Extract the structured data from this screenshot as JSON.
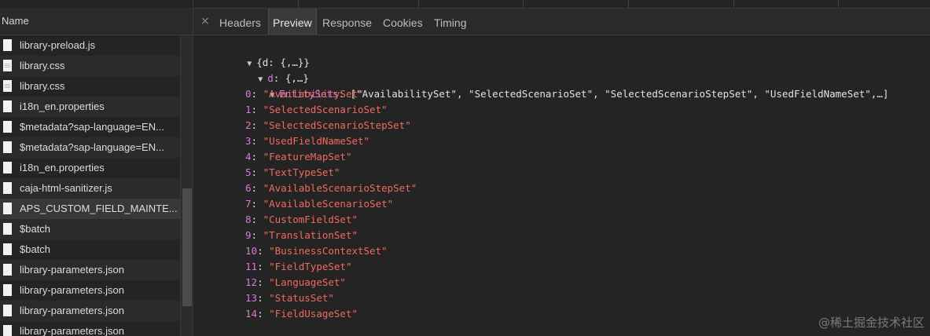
{
  "request_list": {
    "header": "Name",
    "items": [
      {
        "name": "library-preload.js",
        "icon": "js-file-icon"
      },
      {
        "name": "library.css",
        "icon": "css-file-icon"
      },
      {
        "name": "library.css",
        "icon": "css-file-icon"
      },
      {
        "name": "i18n_en.properties",
        "icon": "file-icon"
      },
      {
        "name": "$metadata?sap-language=EN...",
        "icon": "file-icon"
      },
      {
        "name": "$metadata?sap-language=EN...",
        "icon": "file-icon"
      },
      {
        "name": "i18n_en.properties",
        "icon": "file-icon"
      },
      {
        "name": "caja-html-sanitizer.js",
        "icon": "js-file-icon"
      },
      {
        "name": "APS_CUSTOM_FIELD_MAINTE...",
        "icon": "file-icon"
      },
      {
        "name": "$batch",
        "icon": "file-icon"
      },
      {
        "name": "$batch",
        "icon": "file-icon"
      },
      {
        "name": "library-parameters.json",
        "icon": "file-icon"
      },
      {
        "name": "library-parameters.json",
        "icon": "file-icon"
      },
      {
        "name": "library-parameters.json",
        "icon": "file-icon"
      },
      {
        "name": "library-parameters.json",
        "icon": "file-icon"
      }
    ]
  },
  "tabs": {
    "close": "×",
    "items": [
      "Headers",
      "Preview",
      "Response",
      "Cookies",
      "Timing"
    ],
    "active": "Preview"
  },
  "preview": {
    "root": "{d: {,…}}",
    "d_key": "d",
    "d_value": "{,…}",
    "entity_sets_key": "EntitySets",
    "entity_sets_summary": "[\"AvailabilitySet\", \"SelectedScenarioSet\", \"SelectedScenarioStepSet\", \"UsedFieldNameSet\",…]",
    "entries": [
      {
        "index": "0",
        "value": "\"AvailabilitySet\""
      },
      {
        "index": "1",
        "value": "\"SelectedScenarioSet\""
      },
      {
        "index": "2",
        "value": "\"SelectedScenarioStepSet\""
      },
      {
        "index": "3",
        "value": "\"UsedFieldNameSet\""
      },
      {
        "index": "4",
        "value": "\"FeatureMapSet\""
      },
      {
        "index": "5",
        "value": "\"TextTypeSet\""
      },
      {
        "index": "6",
        "value": "\"AvailableScenarioStepSet\""
      },
      {
        "index": "7",
        "value": "\"AvailableScenarioSet\""
      },
      {
        "index": "8",
        "value": "\"CustomFieldSet\""
      },
      {
        "index": "9",
        "value": "\"TranslationSet\""
      },
      {
        "index": "10",
        "value": "\"BusinessContextSet\""
      },
      {
        "index": "11",
        "value": "\"FieldTypeSet\""
      },
      {
        "index": "12",
        "value": "\"LanguageSet\""
      },
      {
        "index": "13",
        "value": "\"StatusSet\""
      },
      {
        "index": "14",
        "value": "\"FieldUsageSet\""
      }
    ]
  },
  "watermark": "@稀土掘金技术社区",
  "colors": {
    "background": "#242424",
    "key": "#d57bd5",
    "string": "#ef6a5e"
  }
}
